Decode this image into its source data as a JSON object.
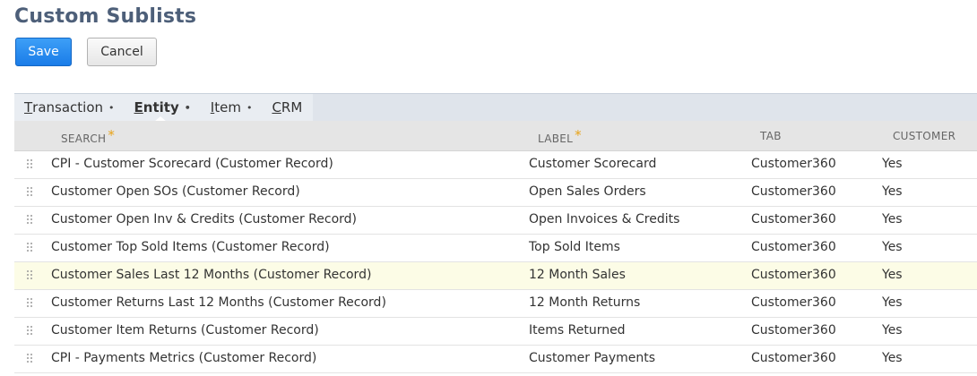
{
  "page": {
    "title": "Custom Sublists"
  },
  "toolbar": {
    "save_label": "Save",
    "cancel_label": "Cancel"
  },
  "tabs": [
    {
      "first": "T",
      "rest": "ransaction",
      "bullet": "•",
      "active": false
    },
    {
      "first": "E",
      "rest": "ntity",
      "bullet": "•",
      "active": true
    },
    {
      "first": "I",
      "rest": "tem",
      "bullet": "•",
      "active": false
    },
    {
      "first": "C",
      "rest": "RM",
      "bullet": "",
      "active": false
    }
  ],
  "table": {
    "columns": {
      "search": "SEARCH",
      "label": "LABEL",
      "tab": "TAB",
      "customer": "CUSTOMER",
      "required_mark": "*"
    },
    "rows": [
      {
        "search": "CPI - Customer Scorecard (Customer Record)",
        "label": "Customer Scorecard",
        "tab": "Customer360",
        "customer": "Yes"
      },
      {
        "search": "Customer Open SOs (Customer Record)",
        "label": "Open Sales Orders",
        "tab": "Customer360",
        "customer": "Yes"
      },
      {
        "search": "Customer Open Inv & Credits (Customer Record)",
        "label": "Open Invoices & Credits",
        "tab": "Customer360",
        "customer": "Yes"
      },
      {
        "search": "Customer Top Sold Items (Customer Record)",
        "label": "Top Sold Items",
        "tab": "Customer360",
        "customer": "Yes"
      },
      {
        "search": "Customer Sales Last 12 Months (Customer Record)",
        "label": "12 Month Sales",
        "tab": "Customer360",
        "customer": "Yes",
        "highlight": true
      },
      {
        "search": "Customer Returns Last 12 Months (Customer Record)",
        "label": "12 Month Returns",
        "tab": "Customer360",
        "customer": "Yes"
      },
      {
        "search": "Customer Item Returns (Customer Record)",
        "label": "Items Returned",
        "tab": "Customer360",
        "customer": "Yes"
      },
      {
        "search": "CPI - Payments Metrics (Customer Record)",
        "label": "Customer Payments",
        "tab": "Customer360",
        "customer": "Yes"
      }
    ]
  },
  "colors": {
    "title": "#4d5f79",
    "save_button": "#1a7ce8",
    "tab_bar": "#dfe4eb",
    "header_bg": "#e5e5e5",
    "required_mark": "#e8a317",
    "row_highlight": "#fcfce6"
  },
  "icons": {
    "drag_handle": "drag-handle-icon"
  }
}
